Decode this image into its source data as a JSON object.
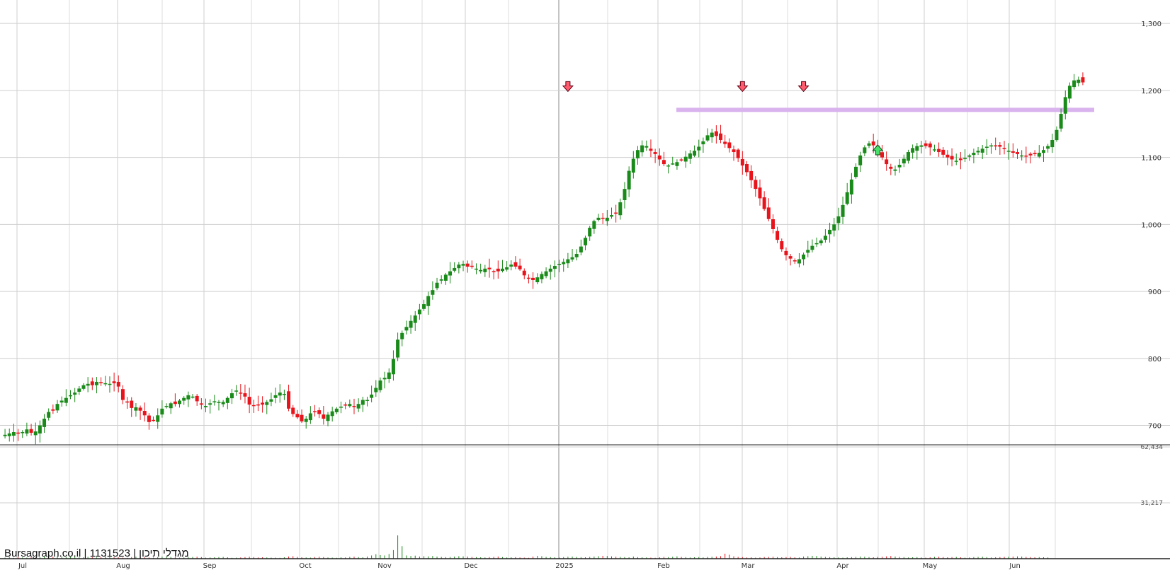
{
  "title": "Bursagraph.co.il | 1131523 | מגדלי תיכון",
  "chart_data": {
    "type": "candlestick",
    "price_axis": {
      "ticks": [
        "1,300",
        "1,200",
        "1,100",
        "1,000",
        "900",
        "800",
        "700"
      ],
      "tick_values": [
        1300,
        1200,
        1100,
        1000,
        900,
        800,
        700
      ],
      "range": [
        671,
        1335
      ]
    },
    "volume_axis": {
      "ticks": [
        "62,434",
        "31,217"
      ],
      "tick_values": [
        62434,
        31217
      ],
      "range": [
        0,
        62434
      ]
    },
    "month_labels": [
      "Jul",
      "Aug",
      "Sep",
      "Oct",
      "Nov",
      "Dec",
      "2025",
      "Feb",
      "Mar",
      "Apr",
      "May",
      "Jun"
    ],
    "resistance_level": 1171,
    "resistance_color": "#d9b3ee",
    "up_color": "#1a8a1a",
    "down_color": "#e8141c",
    "annotations": [
      {
        "type": "down-arrow",
        "bar": 129,
        "price": 1190
      },
      {
        "type": "down-arrow",
        "bar": 169,
        "price": 1190
      },
      {
        "type": "down-arrow",
        "bar": 183,
        "price": 1190
      },
      {
        "type": "up-arrow",
        "bar": 200,
        "price": 1127
      }
    ],
    "closes": [
      686,
      688,
      690,
      688,
      690,
      694,
      689,
      691,
      700,
      710,
      720,
      722,
      732,
      737,
      741,
      745,
      749,
      755,
      760,
      762,
      760,
      765,
      764,
      763,
      762,
      763,
      758,
      738,
      735,
      726,
      727,
      722,
      715,
      705,
      708,
      715,
      725,
      729,
      733,
      732,
      737,
      741,
      745,
      743,
      736,
      731,
      729,
      733,
      736,
      735,
      735,
      741,
      748,
      752,
      748,
      743,
      731,
      729,
      730,
      731,
      735,
      739,
      745,
      749,
      747,
      725,
      717,
      712,
      706,
      710,
      718,
      720,
      717,
      710,
      716,
      721,
      725,
      728,
      731,
      732,
      729,
      732,
      738,
      738,
      746,
      756,
      767,
      771,
      779,
      799,
      828,
      838,
      847,
      856,
      864,
      873,
      881,
      893,
      902,
      913,
      918,
      925,
      930,
      935,
      940,
      941,
      937,
      937,
      934,
      932,
      934,
      933,
      930,
      930,
      934,
      936,
      940,
      937,
      933,
      924,
      920,
      917,
      921,
      926,
      930,
      934,
      938,
      941,
      944,
      948,
      951,
      956,
      967,
      980,
      995,
      1005,
      1010,
      1009,
      1010,
      1014,
      1016,
      1033,
      1053,
      1080,
      1098,
      1111,
      1118,
      1117,
      1110,
      1105,
      1097,
      1090,
      1088,
      1091,
      1093,
      1096,
      1101,
      1106,
      1110,
      1116,
      1124,
      1133,
      1137,
      1132,
      1126,
      1120,
      1114,
      1108,
      1099,
      1088,
      1078,
      1066,
      1053,
      1039,
      1023,
      1008,
      993,
      977,
      963,
      954,
      949,
      945,
      948,
      955,
      962,
      968,
      972,
      976,
      983,
      992,
      1000,
      1012,
      1029,
      1048,
      1067,
      1086,
      1103,
      1115,
      1121,
      1118,
      1111,
      1100,
      1090,
      1083,
      1082,
      1089,
      1098,
      1108,
      1114,
      1117,
      1118,
      1117,
      1115,
      1112,
      1108,
      1104,
      1100,
      1097,
      1095,
      1096,
      1099,
      1103,
      1107,
      1110,
      1113,
      1116,
      1118,
      1118,
      1116,
      1113,
      1110,
      1107,
      1105,
      1103,
      1102,
      1103,
      1105,
      1107,
      1111,
      1117,
      1126,
      1141,
      1165,
      1190,
      1207,
      1215,
      1216,
      1212
    ],
    "volumes": [
      600,
      800,
      500,
      900,
      700,
      600,
      800,
      600,
      900,
      1200,
      1500,
      1100,
      1400,
      1300,
      900,
      1000,
      1200,
      900,
      800,
      1100,
      900,
      700,
      900,
      1300,
      1000,
      800,
      700,
      600,
      500,
      900,
      1100,
      1000,
      800,
      700,
      600,
      900,
      1200,
      1100,
      1000,
      800,
      600,
      700,
      900,
      1000,
      1100,
      900,
      600,
      700,
      800,
      900,
      1000,
      800,
      500,
      600,
      700,
      900,
      1100,
      900,
      700,
      800,
      700,
      600,
      600,
      500,
      800,
      1200,
      1400,
      1000,
      800,
      700,
      600,
      900,
      1100,
      900,
      700,
      600,
      500,
      800,
      700,
      1000,
      1100,
      900,
      800,
      1200,
      1800,
      2500,
      2000,
      1800,
      2600,
      4800,
      13000,
      7000,
      1800,
      1500,
      1700,
      1200,
      1400,
      1300,
      1500,
      1200,
      1000,
      900,
      1000,
      1200,
      1400,
      1300,
      1200,
      1000,
      900,
      800,
      700,
      900,
      1000,
      1200,
      900,
      700,
      800,
      900,
      700,
      600,
      500,
      1200,
      1600,
      1400,
      1000,
      900,
      800,
      700,
      900,
      1100,
      1200,
      1000,
      900,
      800,
      1000,
      1200,
      1400,
      1600,
      1500,
      1300,
      1100,
      1000,
      900,
      800,
      1200,
      900,
      800,
      700,
      600,
      500,
      800,
      1000,
      900,
      1100,
      1300,
      1000,
      900,
      700,
      800,
      900,
      700,
      1000,
      1100,
      1200,
      1400,
      2800,
      2200,
      1300,
      1000,
      900,
      700,
      800,
      600,
      700,
      900,
      1000,
      1100,
      900,
      800,
      900,
      1000,
      800,
      700,
      1200,
      1400,
      1600,
      1500,
      1200,
      1000,
      900,
      800,
      700,
      600,
      800,
      900,
      1000,
      1200,
      1100,
      900,
      800,
      1000,
      1100,
      1300,
      1500,
      1200,
      1000,
      900,
      700,
      800,
      900,
      700,
      600,
      800,
      1000,
      1100,
      900,
      800,
      900,
      1000,
      800,
      600,
      700,
      900,
      1000,
      1100,
      900,
      700,
      800,
      900,
      1000,
      1100,
      1200,
      1300,
      1200,
      1000,
      900,
      800,
      900,
      800,
      700
    ],
    "volume_colors_hint": "bars colored by candle direction"
  }
}
